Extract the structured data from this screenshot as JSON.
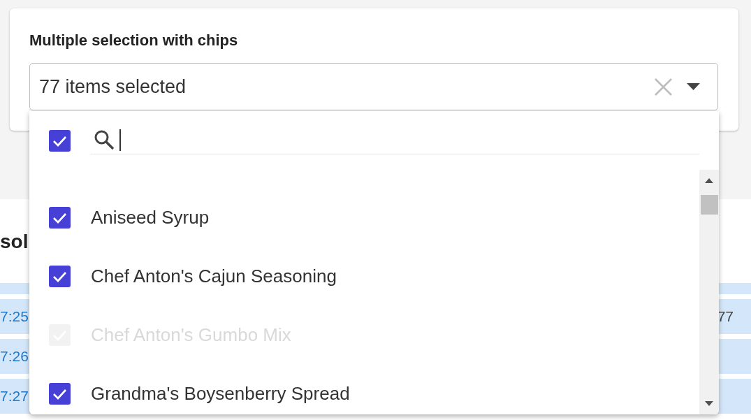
{
  "form_card": {
    "title": "Multiple selection with chips",
    "select": {
      "value": "77 items selected",
      "expanded": true,
      "dropdown": {
        "select_all": {
          "checked": true
        },
        "options": [
          {
            "label": "Aniseed Syrup",
            "checked": true,
            "disabled": false
          },
          {
            "label": "Chef Anton's Cajun Seasoning",
            "checked": true,
            "disabled": false
          },
          {
            "label": "Chef Anton's Gumbo Mix",
            "checked": true,
            "disabled": true
          },
          {
            "label": "Grandma's Boysenberry Spread",
            "checked": true,
            "disabled": false
          }
        ]
      }
    }
  },
  "background_section": {
    "heading": "sol",
    "rows": [
      {
        "column_1": "7:25",
        "column_2": "77"
      },
      {
        "column_1": "7:26"
      },
      {
        "column_1": "7:27"
      }
    ]
  }
}
